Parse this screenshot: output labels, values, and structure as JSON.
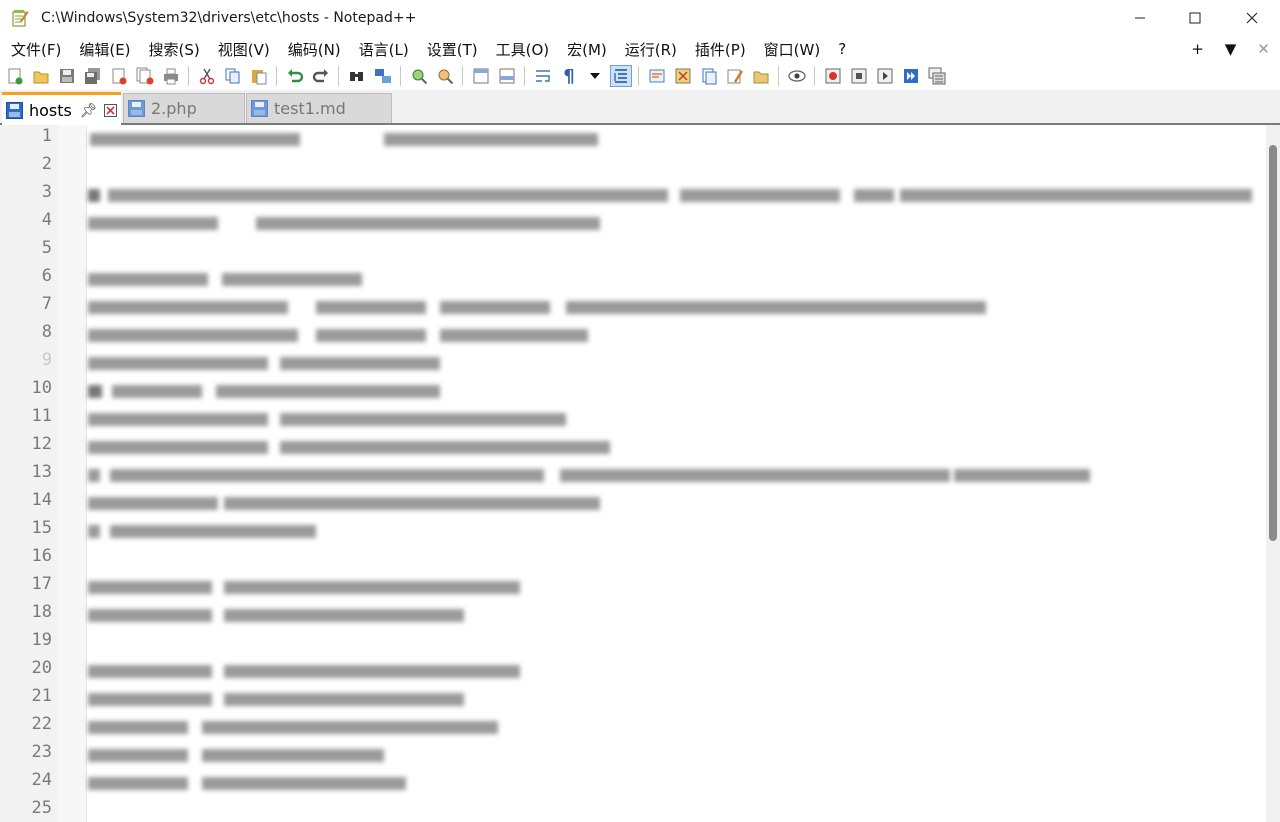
{
  "window": {
    "title": "C:\\Windows\\System32\\drivers\\etc\\hosts - Notepad++",
    "minimize_glyph": "—",
    "maximize_glyph": "☐",
    "close_glyph": "✕"
  },
  "menu": {
    "items": [
      "文件(F)",
      "编辑(E)",
      "搜索(S)",
      "视图(V)",
      "编码(N)",
      "语言(L)",
      "设置(T)",
      "工具(O)",
      "宏(M)",
      "运行(R)",
      "插件(P)",
      "窗口(W)",
      "?"
    ],
    "right": [
      "+",
      "▼",
      "✕"
    ]
  },
  "toolbar": {
    "icons": [
      "new-file-icon",
      "open-file-icon",
      "save-icon",
      "save-all-icon",
      "close-icon",
      "close-all-icon",
      "print-icon",
      "cut-icon",
      "copy-icon",
      "paste-icon",
      "undo-icon",
      "redo-icon",
      "find-icon",
      "replace-icon",
      "zoom-in-icon",
      "zoom-out-icon",
      "sync-vertical-icon",
      "sync-horizontal-icon",
      "word-wrap-icon",
      "show-all-characters-icon",
      "dropdown-icon",
      "indent-guide-icon",
      "user-defined-language-icon",
      "doc-map-icon",
      "function-list-icon",
      "folder-as-workspace-icon",
      "folder-icon",
      "monitoring-icon",
      "record-macro-icon",
      "stop-record-icon",
      "playback-macro-icon",
      "run-macro-multiple-icon",
      "save-macro-icon"
    ]
  },
  "tabs": [
    {
      "label": "hosts",
      "active": true
    },
    {
      "label": "2.php",
      "active": false
    },
    {
      "label": "test1.md",
      "active": false
    }
  ],
  "editor": {
    "line_numbers": [
      "1",
      "2",
      "3",
      "4",
      "5",
      "6",
      "7",
      "8",
      "9",
      "10",
      "11",
      "12",
      "13",
      "14",
      "15",
      "16",
      "17",
      "18",
      "19",
      "20",
      "21",
      "22",
      "23",
      "24",
      "25"
    ],
    "content_note": "Content is blurred/pixelated in the screenshot"
  },
  "colors": {
    "active_tab_accent": "#f6a21c",
    "tab_icon_blue": "#2d6fc6",
    "gutter_bg": "#f2f2f2",
    "line_number": "#7a7a7a"
  }
}
